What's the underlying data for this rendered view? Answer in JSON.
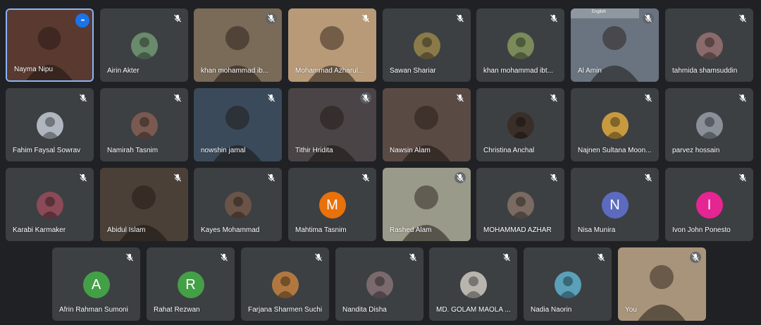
{
  "screenshot_overlay": {
    "language_label": "English"
  },
  "participants": [
    {
      "name": "Nayma Nipu",
      "mic": "more",
      "type": "video",
      "video_bg": "#5a3a30",
      "active": true
    },
    {
      "name": "Airin Akter",
      "mic": "muted",
      "type": "photo",
      "photo_color": "#6a8a6c"
    },
    {
      "name": "khan mohammad ib...",
      "mic": "muted-circle",
      "type": "video",
      "video_bg": "#7a6a58"
    },
    {
      "name": "Mohammad Azharul...",
      "mic": "muted",
      "type": "video",
      "video_bg": "#b89a78"
    },
    {
      "name": "Sawan Shariar",
      "mic": "muted",
      "type": "photo",
      "photo_color": "#8a7a4a"
    },
    {
      "name": "khan mohammad ibt...",
      "mic": "muted",
      "type": "photo",
      "photo_color": "#7a8a5a"
    },
    {
      "name": "Al Amin",
      "mic": "muted-circle",
      "type": "video",
      "video_bg": "#6a7480"
    },
    {
      "name": "tahmida shamsuddin",
      "mic": "muted",
      "type": "photo",
      "photo_color": "#8a6a6a"
    },
    {
      "name": "Fahim Faysal Sowrav",
      "mic": "muted",
      "type": "photo",
      "photo_color": "#b0b6c0"
    },
    {
      "name": "Namirah Tasnim",
      "mic": "muted",
      "type": "photo",
      "photo_color": "#7a5a50"
    },
    {
      "name": "nowshin jamal",
      "mic": "muted",
      "type": "video",
      "video_bg": "#3a4a5a"
    },
    {
      "name": "Tithir Hridita",
      "mic": "muted-circle",
      "type": "video",
      "video_bg": "#4a4446"
    },
    {
      "name": "Nawsin Alam",
      "mic": "muted",
      "type": "video",
      "video_bg": "#5a4a44"
    },
    {
      "name": "Christina Anchal",
      "mic": "muted",
      "type": "photo",
      "photo_color": "#3a2e28"
    },
    {
      "name": "Najnen Sultana Moon...",
      "mic": "muted",
      "type": "photo",
      "photo_color": "#c89a40"
    },
    {
      "name": "parvez hossain",
      "mic": "muted",
      "type": "photo",
      "photo_color": "#8a9098"
    },
    {
      "name": "Karabi Karmaker",
      "mic": "muted",
      "type": "photo",
      "photo_color": "#8a4a58"
    },
    {
      "name": "Abidul Islam",
      "mic": "muted",
      "type": "video",
      "video_bg": "#4a4038"
    },
    {
      "name": "Kayes Mohammad",
      "mic": "muted",
      "type": "photo",
      "photo_color": "#6a5448"
    },
    {
      "name": "Mahtima Tasnim",
      "mic": "muted",
      "type": "letter",
      "letter": "M",
      "letter_color": "#e8710a"
    },
    {
      "name": "Rashed Alam",
      "mic": "muted-circle",
      "type": "video",
      "video_bg": "#9a9a8a"
    },
    {
      "name": "MOHAMMAD AZHAR",
      "mic": "muted",
      "type": "photo",
      "photo_color": "#7a6a62"
    },
    {
      "name": "Nisa Munira",
      "mic": "muted",
      "type": "letter",
      "letter": "N",
      "letter_color": "#5c6bc0"
    },
    {
      "name": "Ivon John Ponesto",
      "mic": "muted",
      "type": "letter",
      "letter": "I",
      "letter_color": "#e52592"
    },
    {
      "name": "Afrin Rahman Sumoni",
      "mic": "muted",
      "type": "letter",
      "letter": "A",
      "letter_color": "#43a047"
    },
    {
      "name": "Rahat Rezwan",
      "mic": "muted",
      "type": "letter",
      "letter": "R",
      "letter_color": "#43a047"
    },
    {
      "name": "Farjana Sharmen Suchi",
      "mic": "muted",
      "type": "photo",
      "photo_color": "#b07840"
    },
    {
      "name": "Nandita Disha",
      "mic": "muted",
      "type": "photo",
      "photo_color": "#7a6a6e"
    },
    {
      "name": "MD. GOLAM MAOLA ...",
      "mic": "muted",
      "type": "photo",
      "photo_color": "#b8b4ae"
    },
    {
      "name": "Nadia Naorin",
      "mic": "muted",
      "type": "photo",
      "photo_color": "#5aa0b8"
    },
    {
      "name": "You",
      "mic": "muted-circle",
      "type": "video",
      "video_bg": "#a8947a"
    }
  ]
}
